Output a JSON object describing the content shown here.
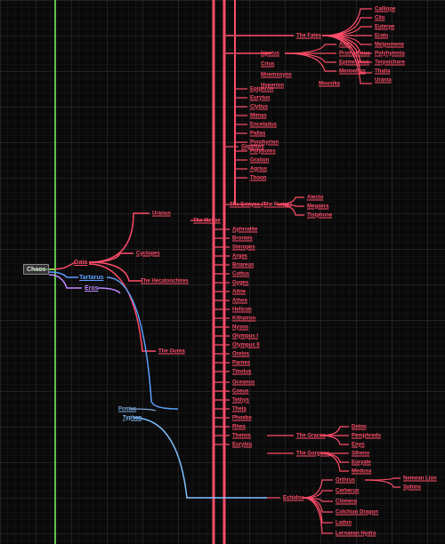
{
  "root": "Chaos",
  "primordials": {
    "gaia": "Gaia",
    "tartarus": "Tartarus",
    "eros": "Eros",
    "pontus": "Pontus",
    "typhon": "Typhon",
    "uranus": "Uranus"
  },
  "groups": {
    "cyclopes": "Cyclopes",
    "hecatonchires": "The Hecatonchires",
    "ourea": "The Ourea",
    "erinyes": "The Erinyes (The Furies)",
    "gigantes": "Gigantes",
    "meliae": "The Meliae",
    "fates": "The Fates",
    "graces": "The Graces",
    "gorgons": "The Gorgons",
    "muses": "Mousika"
  },
  "fates_children": [
    "Calliope",
    "Clio",
    "Euterpe",
    "Erato",
    "Melpomene",
    "Polyhymnia",
    "Terpsichore",
    "Thalia",
    "Urania"
  ],
  "top_titans": [
    "Iapetus",
    "Crius",
    "Mnemosyne",
    "Hyperion"
  ],
  "iapetus_children": [
    "Atlas",
    "Prometheus",
    "Epimetheus",
    "Menoetius"
  ],
  "gigantes_list": [
    "Epiphron",
    "Eurytus",
    "Clytius",
    "Mimas",
    "Enceladus",
    "Pallas",
    "Porphyrion",
    "Polybotes",
    "Gration",
    "Agrius",
    "Thoon"
  ],
  "erinyes_list": [
    "Alecto",
    "Megaera",
    "Tisiphone"
  ],
  "meliae_list": [
    "Aphrodite",
    "Brontes",
    "Steropes",
    "Arges",
    "Briareus",
    "Cottus",
    "Gyges",
    "Aitne",
    "Athos",
    "Helicon",
    "Kithairon",
    "Nysos",
    "Olympus I",
    "Olympus II",
    "Oreios",
    "Parnes",
    "Tmolus"
  ],
  "ourea_extra": [
    "Oceanus",
    "Coeus",
    "Tethys",
    "Theia",
    "Phoebe",
    "Rhea",
    "Themis",
    "Eurybia"
  ],
  "graces_list": [
    "Deino",
    "Pemphredo",
    "Enyo",
    "Stheno",
    "Euryale",
    "Medusa"
  ],
  "echidna": "Echidna",
  "echidna_children": [
    "Orthrus",
    "Cerberus",
    "Chimera",
    "Colchian Dragon",
    "Ladon",
    "Lernaean Hydra"
  ],
  "echidna_grand": [
    "Nemean Lion",
    "Sphinx"
  ],
  "colors": {
    "pink": "#ff4d6a",
    "green": "#7aff5a",
    "blue": "#5aa0ff",
    "purple": "#c08aff",
    "lightblue": "#7fbfff"
  }
}
